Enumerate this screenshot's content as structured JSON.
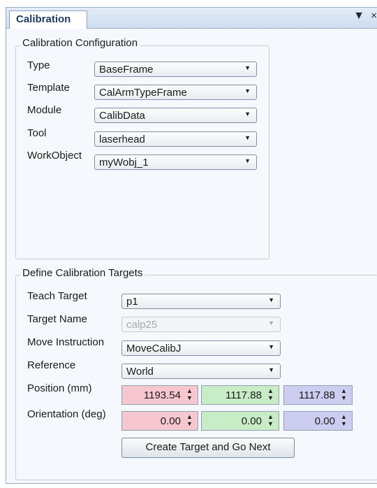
{
  "window": {
    "tab_title": "Calibration",
    "pin_glyph": "▼",
    "close_glyph": "×"
  },
  "config": {
    "title": "Calibration Configuration",
    "fields": [
      {
        "label": "Type",
        "value": "BaseFrame"
      },
      {
        "label": "Template",
        "value": "CalArmTypeFrame"
      },
      {
        "label": "Module",
        "value": "CalibData"
      },
      {
        "label": "Tool",
        "value": "laserhead"
      },
      {
        "label": "WorkObject",
        "value": "myWobj_1"
      }
    ]
  },
  "targets": {
    "title": "Define Calibration Targets",
    "teach_target": {
      "label": "Teach Target",
      "value": "p1"
    },
    "target_name": {
      "label": "Target Name",
      "value": "calp25"
    },
    "move_instruction": {
      "label": "Move Instruction",
      "value": "MoveCalibJ"
    },
    "reference": {
      "label": "Reference",
      "value": "World"
    },
    "position": {
      "label": "Position (mm)",
      "x": "1193.54",
      "y": "1117.88",
      "z": "1117.88"
    },
    "orientation": {
      "label": "Orientation (deg)",
      "x": "0.00",
      "y": "0.00",
      "z": "0.00"
    },
    "create_button": "Create Target and Go Next"
  },
  "colors": {
    "x_field": "#f7c7cf",
    "y_field": "#c8ecc6",
    "z_field": "#cdcdf1"
  },
  "icons": {
    "dropdown": "▼",
    "spin_up": "▲",
    "spin_down": "▼"
  }
}
